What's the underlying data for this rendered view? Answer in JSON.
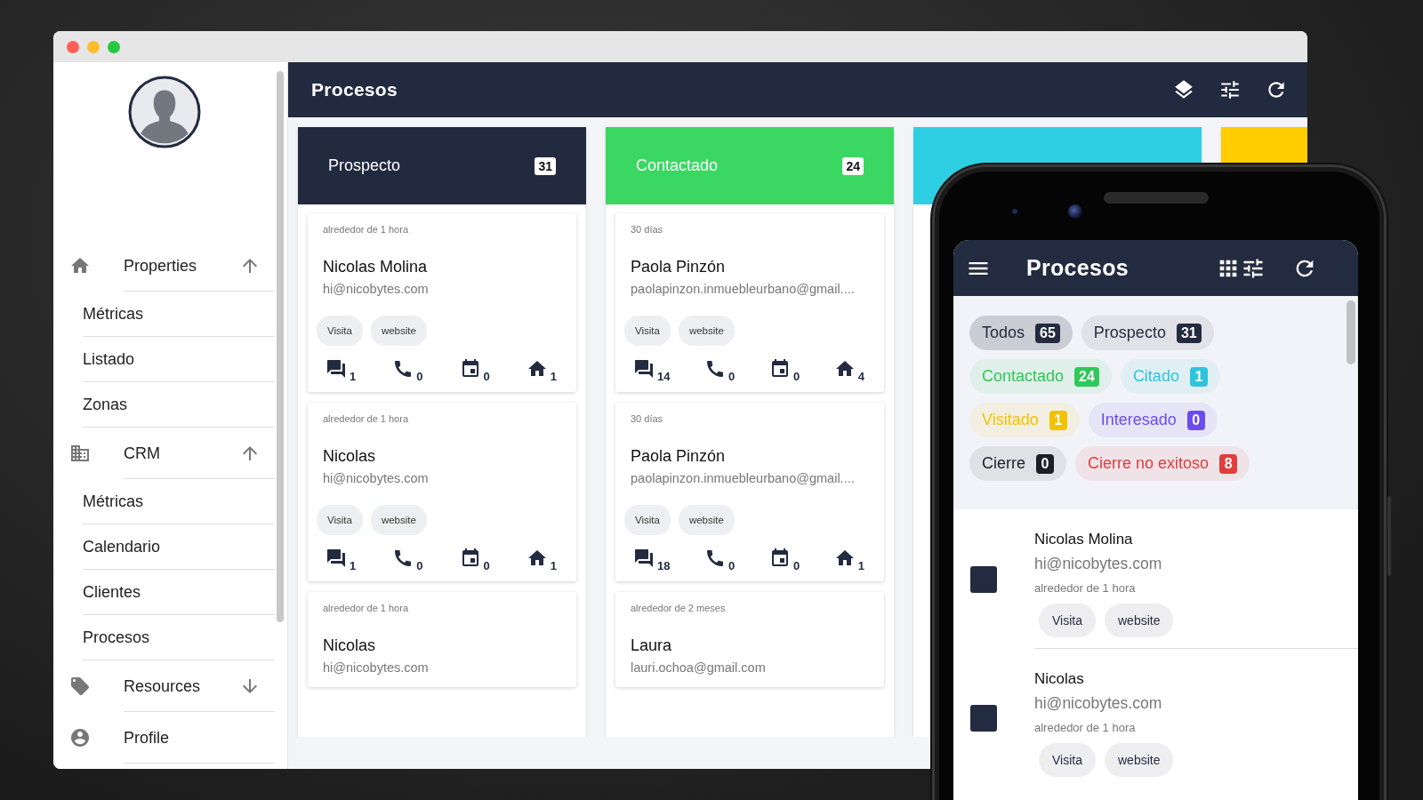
{
  "desktop": {
    "sidebar": {
      "sections": [
        {
          "label": "Properties",
          "expanded": true,
          "children": [
            {
              "label": "Métricas"
            },
            {
              "label": "Listado"
            },
            {
              "label": "Zonas"
            }
          ]
        },
        {
          "label": "CRM",
          "expanded": true,
          "children": [
            {
              "label": "Métricas"
            },
            {
              "label": "Calendario"
            },
            {
              "label": "Clientes"
            },
            {
              "label": "Procesos"
            }
          ]
        },
        {
          "label": "Resources",
          "expanded": false
        },
        {
          "label": "Profile"
        }
      ]
    },
    "header": {
      "title": "Procesos"
    },
    "columns": [
      {
        "title": "Prospecto",
        "count": "31",
        "color": "#222a3f",
        "cards": [
          {
            "time": "alrededor de 1 hora",
            "name": "Nicolas Molina",
            "email": "hi@nicobytes.com",
            "tags": [
              "Visita",
              "website"
            ],
            "stats": [
              "1",
              "0",
              "0",
              "1"
            ]
          },
          {
            "time": "alrededor de 1 hora",
            "name": "Nicolas",
            "email": "hi@nicobytes.com",
            "tags": [
              "Visita",
              "website"
            ],
            "stats": [
              "1",
              "0",
              "0",
              "1"
            ]
          },
          {
            "time": "alrededor de 1 hora",
            "name": "Nicolas",
            "email": "hi@nicobytes.com"
          }
        ]
      },
      {
        "title": "Contactado",
        "count": "24",
        "color": "#3ad862",
        "cards": [
          {
            "time": "30 días",
            "name": "Paola Pinzón",
            "email": "paolapinzon.inmuebleurbano@gmail....",
            "tags": [
              "Visita",
              "website"
            ],
            "stats": [
              "14",
              "0",
              "0",
              "4"
            ]
          },
          {
            "time": "30 días",
            "name": "Paola Pinzón",
            "email": "paolapinzon.inmuebleurbano@gmail....",
            "tags": [
              "Visita",
              "website"
            ],
            "stats": [
              "18",
              "0",
              "0",
              "1"
            ]
          },
          {
            "time": "alrededor de 2 meses",
            "name": "Laura",
            "email": "lauri.ochoa@gmail.com"
          }
        ]
      },
      {
        "color": "#2ecfe3"
      },
      {
        "color": "#ffcc00"
      }
    ]
  },
  "mobile": {
    "title": "Procesos",
    "filters": [
      {
        "label": "Todos",
        "count": "65",
        "color": "#232b40",
        "selected": true
      },
      {
        "label": "Prospecto",
        "count": "31",
        "color": "#232b40",
        "selected": false
      },
      {
        "label": "Contactado",
        "count": "24",
        "color": "#2fc85a",
        "selected": false
      },
      {
        "label": "Citado",
        "count": "1",
        "color": "#2ec4dc",
        "selected": false
      },
      {
        "label": "Visitado",
        "count": "1",
        "color": "#f2c200",
        "selected": false
      },
      {
        "label": "Interesado",
        "count": "0",
        "color": "#6a4cf0",
        "selected": false
      },
      {
        "label": "Cierre",
        "count": "0",
        "color": "#1d1f24",
        "selected": false
      },
      {
        "label": "Cierre no exitoso",
        "count": "8",
        "color": "#e23c3c",
        "selected": false
      }
    ],
    "contacts": [
      {
        "name": "Nicolas Molina",
        "email": "hi@nicobytes.com",
        "time": "alrededor de 1 hora",
        "tags": [
          "Visita",
          "website"
        ]
      },
      {
        "name": "Nicolas",
        "email": "hi@nicobytes.com",
        "time": "alrededor de 1 hora",
        "tags": [
          "Visita",
          "website"
        ]
      }
    ]
  }
}
